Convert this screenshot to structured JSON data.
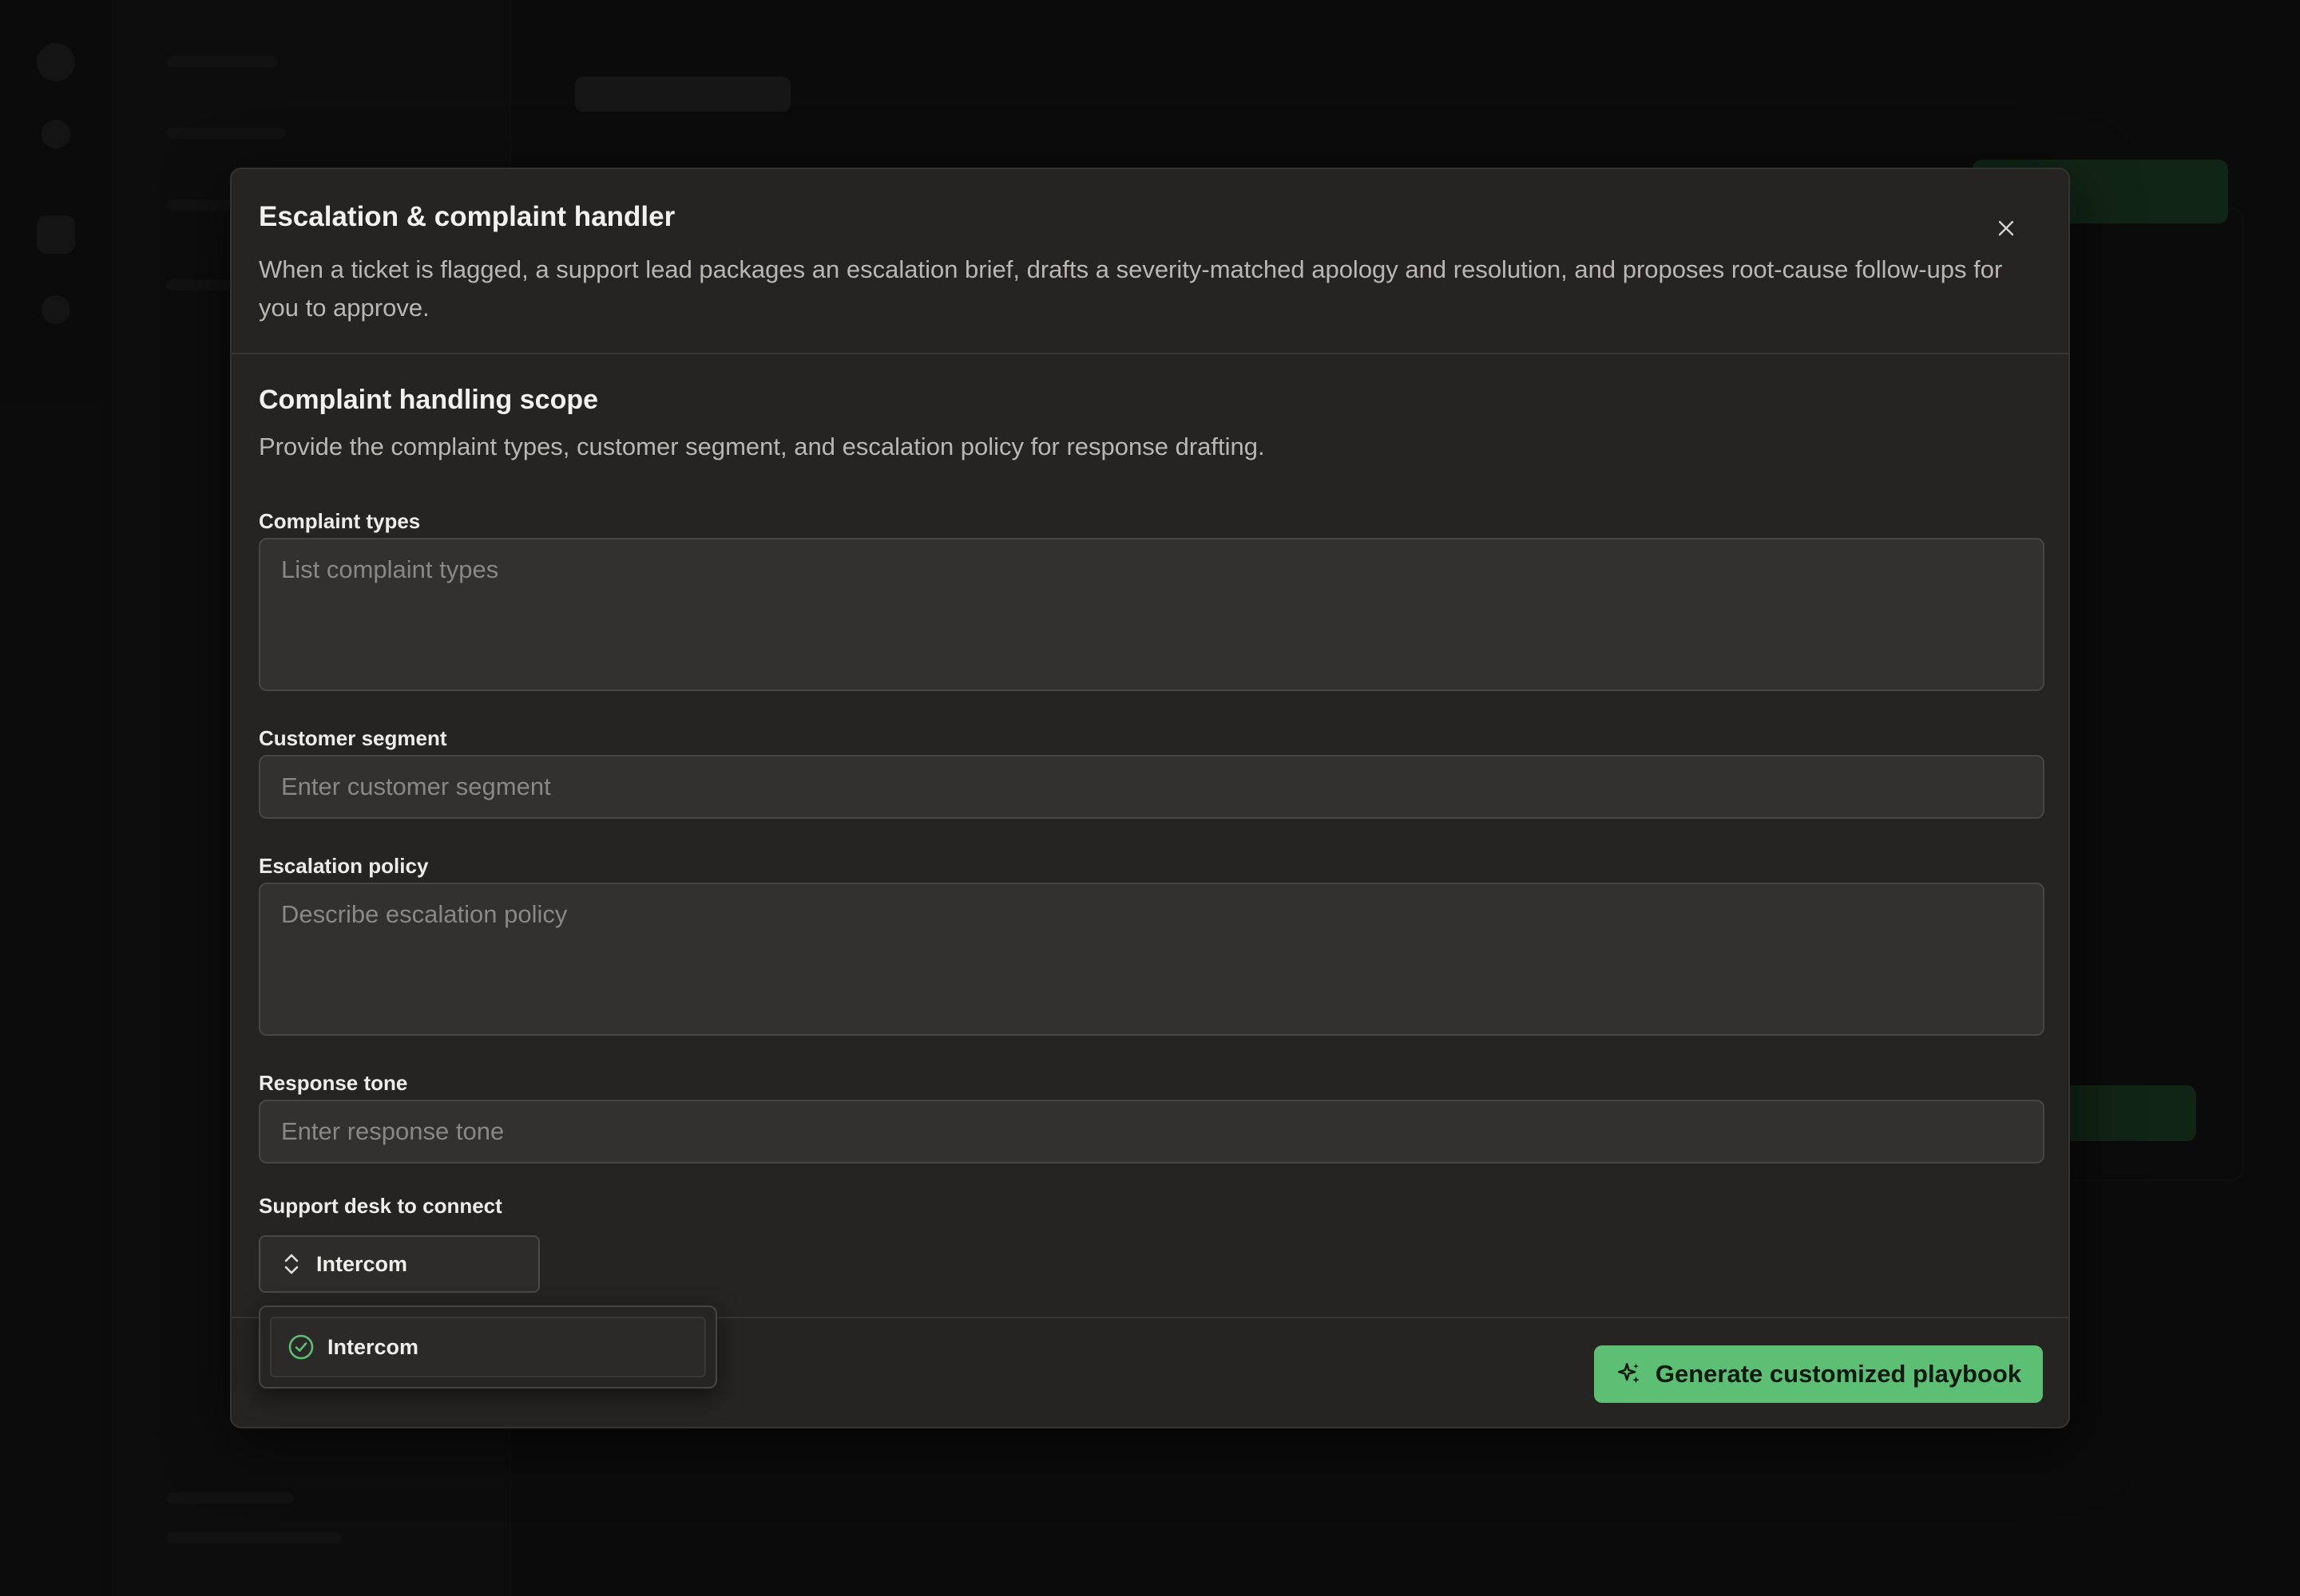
{
  "modal": {
    "title": "Escalation & complaint handler",
    "description": "When a ticket is flagged, a support lead packages an escalation brief, drafts a severity-matched apology and resolution, and proposes root-cause follow-ups for you to approve.",
    "close_icon": "close-icon"
  },
  "section": {
    "title": "Complaint handling scope",
    "description": "Provide the complaint types, customer segment, and escalation policy for response drafting."
  },
  "fields": {
    "complaint_types": {
      "label": "Complaint types",
      "placeholder": "List complaint types",
      "value": ""
    },
    "customer_segment": {
      "label": "Customer segment",
      "placeholder": "Enter customer segment",
      "value": ""
    },
    "escalation_policy": {
      "label": "Escalation policy",
      "placeholder": "Describe escalation policy",
      "value": ""
    },
    "response_tone": {
      "label": "Response tone",
      "placeholder": "Enter response tone",
      "value": ""
    },
    "support_desk": {
      "label": "Support desk to connect",
      "selected": "Intercom",
      "options": [
        {
          "label": "Intercom",
          "checked": true
        }
      ]
    }
  },
  "actions": {
    "generate_label": "Generate customized playbook",
    "generate_icon": "sparkles-icon"
  },
  "colors": {
    "accent": "#5cbf73",
    "modal_bg": "#252423",
    "page_bg": "#111111"
  }
}
